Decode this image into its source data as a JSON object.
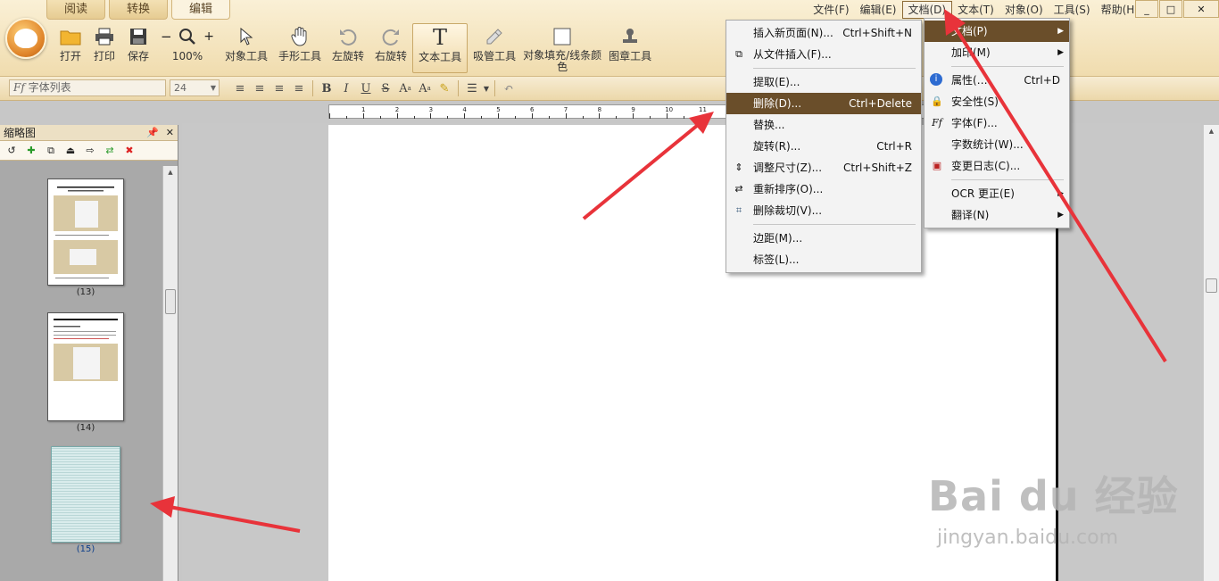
{
  "mode_tabs": [
    "阅读",
    "转换",
    "编辑"
  ],
  "toolbar": [
    {
      "label": "打开",
      "icon": "folder-icon"
    },
    {
      "label": "打印",
      "icon": "printer-icon"
    },
    {
      "label": "保存",
      "icon": "save-icon"
    },
    {
      "label": "100%",
      "icon": "zoom-icon"
    },
    {
      "label": "对象工具",
      "icon": "arrow-cursor-icon"
    },
    {
      "label": "手形工具",
      "icon": "hand-icon"
    },
    {
      "label": "左旋转",
      "icon": "rotate-left-icon"
    },
    {
      "label": "右旋转",
      "icon": "rotate-right-icon"
    },
    {
      "label": "文本工具",
      "icon": "text-tool-icon"
    },
    {
      "label": "吸管工具",
      "icon": "eyedropper-icon"
    },
    {
      "label": "对象填充/线条颜色",
      "icon": "fill-color-icon"
    },
    {
      "label": "图章工具",
      "icon": "stamp-icon"
    }
  ],
  "menubar": [
    "文件(F)",
    "编辑(E)",
    "文档(D)",
    "文本(T)",
    "对象(O)",
    "工具(S)",
    "帮助(H)"
  ],
  "window_controls": [
    "_",
    "□",
    "✕"
  ],
  "format_bar": {
    "font_list": "字体列表",
    "font_size": "24"
  },
  "panel": {
    "title": "缩略图"
  },
  "thumbnails": [
    "(13)",
    "(14)",
    "(15)"
  ],
  "doc_menu": [
    {
      "label": "文档(P)"
    },
    {
      "label": "加印(M)"
    },
    {
      "label": "属性(…"
    },
    {
      "label": "安全性(S)"
    },
    {
      "label": "字体(F)..."
    },
    {
      "label": "字数统计(W)..."
    },
    {
      "label": "变更日志(C)..."
    },
    {
      "label": "OCR 更正(E)"
    },
    {
      "label": "翻译(N)"
    }
  ],
  "doc_menu_shortcuts": {
    "properties": "Ctrl+D"
  },
  "page_menu": [
    {
      "label": "插入新页面(N)...",
      "shortcut": "Ctrl+Shift+N"
    },
    {
      "label": "从文件插入(F)...",
      "shortcut": ""
    },
    {
      "label": "提取(E)...",
      "shortcut": ""
    },
    {
      "label": "删除(D)...",
      "shortcut": "Ctrl+Delete"
    },
    {
      "label": "替换...",
      "shortcut": ""
    },
    {
      "label": "旋转(R)...",
      "shortcut": "Ctrl+R"
    },
    {
      "label": "调整尺寸(Z)...",
      "shortcut": "Ctrl+Shift+Z"
    },
    {
      "label": "重新排序(O)...",
      "shortcut": ""
    },
    {
      "label": "删除裁切(V)...",
      "shortcut": ""
    },
    {
      "label": "边距(M)...",
      "shortcut": ""
    },
    {
      "label": "标签(L)...",
      "shortcut": ""
    }
  ],
  "ruler_numbers": [
    "1",
    "2",
    "3",
    "4",
    "5",
    "6",
    "7",
    "8",
    "9",
    "10",
    "11"
  ],
  "watermark": {
    "main": "Bai du 经验",
    "url": "jingyan.baidu.com"
  },
  "colors": {
    "accent": "#6a4e2a",
    "ribbon": "#f0dcae",
    "arrow": "#e8333a"
  }
}
